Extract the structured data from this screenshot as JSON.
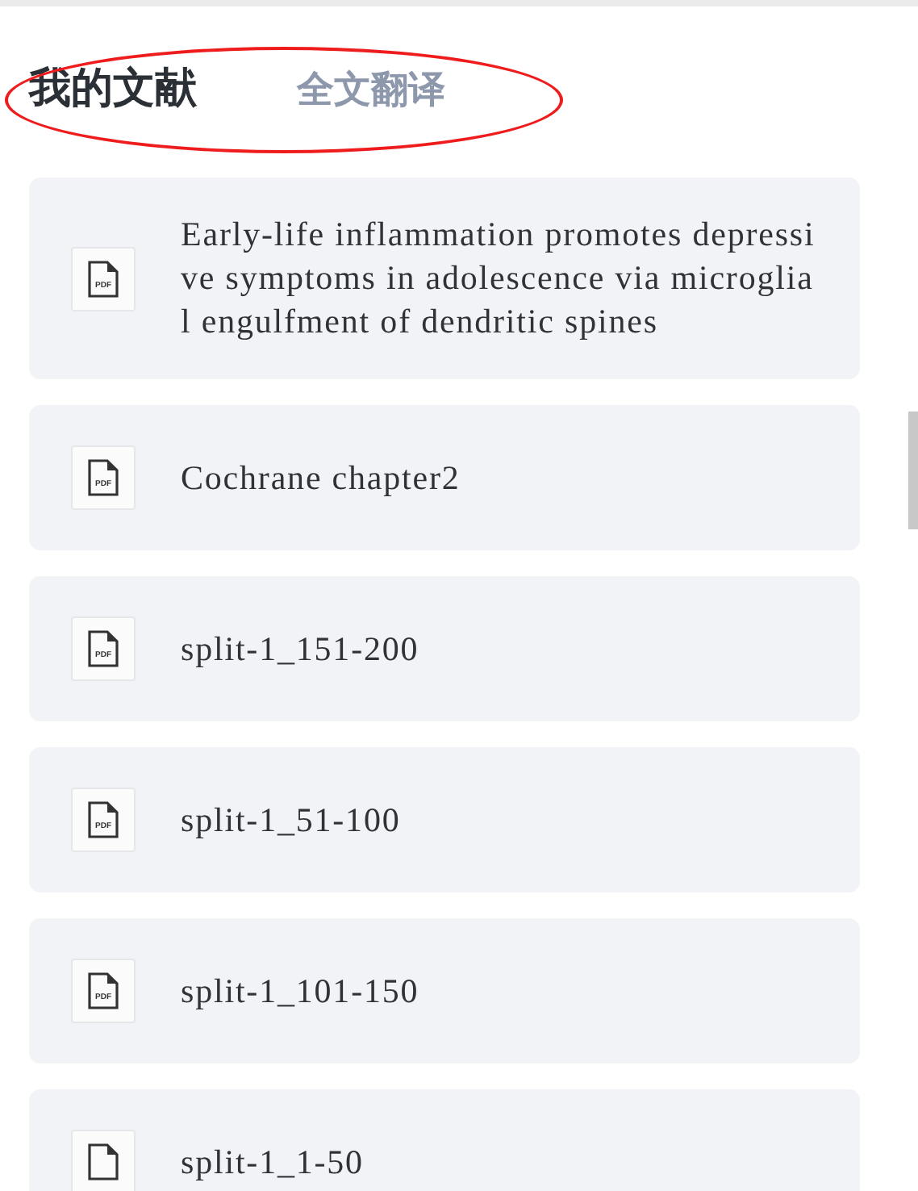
{
  "tabs": [
    {
      "label": "我的文献",
      "selected": true
    },
    {
      "label": "全文翻译",
      "selected": false
    }
  ],
  "documents": [
    {
      "title": "Early-life inflammation promotes depressive symptoms in adolescence via microglial engulfment of dendritic spines",
      "icon_label": "PDF"
    },
    {
      "title": "Cochrane chapter2",
      "icon_label": "PDF"
    },
    {
      "title": "split-1_151-200",
      "icon_label": "PDF"
    },
    {
      "title": "split-1_51-100",
      "icon_label": "PDF"
    },
    {
      "title": "split-1_101-150",
      "icon_label": "PDF"
    },
    {
      "title": "split-1_1-50"
    }
  ]
}
